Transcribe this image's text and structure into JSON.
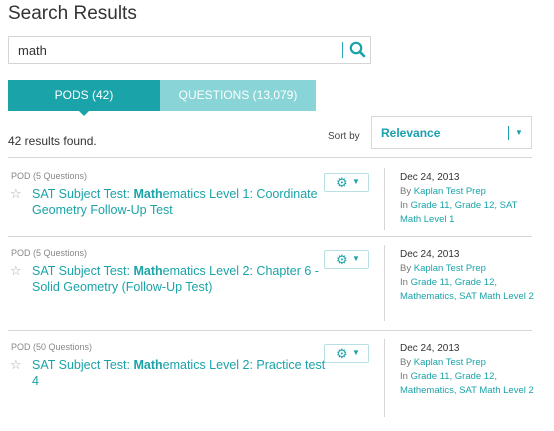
{
  "page": {
    "title": "Search Results"
  },
  "search": {
    "query": "math"
  },
  "tabs": [
    {
      "label": "PODS (42)",
      "active": true
    },
    {
      "label": "QUESTIONS (13,079)",
      "active": false
    }
  ],
  "results": {
    "count_text": "42 results found.",
    "sort_label": "Sort by",
    "sort_value": "Relevance"
  },
  "items": [
    {
      "kind": "POD",
      "questions": "(5 Questions)",
      "title_prefix": "SAT Subject Test: ",
      "title_highlight": "Math",
      "title_rest": "ematics Level 1: Coordinate Geometry Follow-Up Test",
      "date": "Dec 24, 2013",
      "by_label": "By",
      "author": "Kaplan Test Prep",
      "in_label": "In",
      "tags_text": "Grade 11, Grade 12, SAT Math Level 1"
    },
    {
      "kind": "POD",
      "questions": "(5 Questions)",
      "title_prefix": "SAT Subject Test: ",
      "title_highlight": "Math",
      "title_rest": "ematics Level 2: Chapter 6 - Solid Geometry (Follow-Up Test)",
      "date": "Dec 24, 2013",
      "by_label": "By",
      "author": "Kaplan Test Prep",
      "in_label": "In",
      "tags_text": "Grade 11, Grade 12, Mathematics, SAT Math Level 2"
    },
    {
      "kind": "POD",
      "questions": "(50 Questions)",
      "title_prefix": "SAT Subject Test: ",
      "title_highlight": "Math",
      "title_rest": "ematics Level 2: Practice test 4",
      "date": "Dec 24, 2013",
      "by_label": "By",
      "author": "Kaplan Test Prep",
      "in_label": "In",
      "tags_text": "Grade 11, Grade 12, Mathematics, SAT Math Level 2"
    }
  ],
  "icons": {
    "search": "magnifier",
    "star": "☆",
    "gear": "⚙",
    "caret": "▼"
  },
  "colors": {
    "accent": "#1aa3a8",
    "tab_inactive": "#88d4d7"
  }
}
